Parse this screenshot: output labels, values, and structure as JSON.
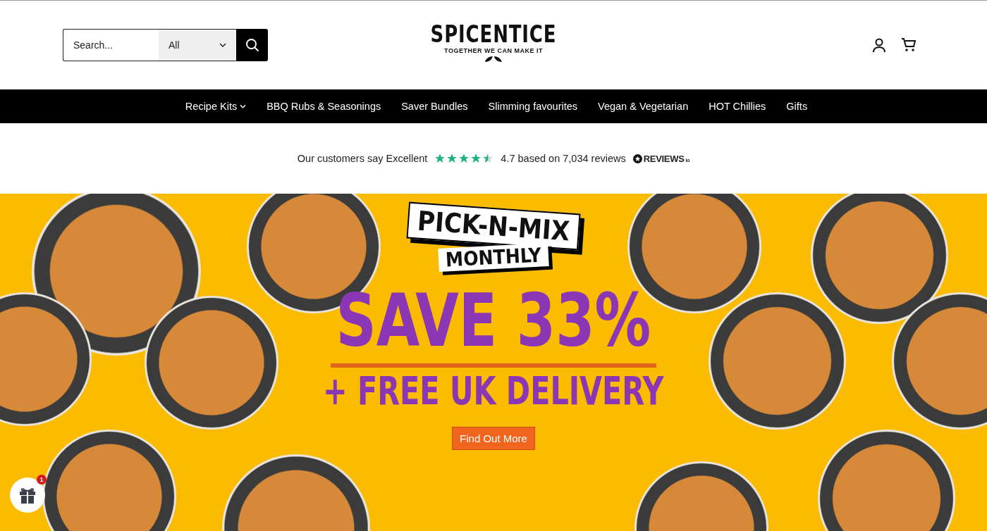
{
  "header": {
    "search": {
      "placeholder": "Search...",
      "category": "All"
    },
    "logo": {
      "name": "SPICENTICE",
      "tagline": "TOGETHER WE CAN MAKE IT"
    }
  },
  "nav": [
    {
      "label": "Recipe Kits",
      "has_dropdown": true
    },
    {
      "label": "BBQ Rubs & Seasonings",
      "has_dropdown": false
    },
    {
      "label": "Saver Bundles",
      "has_dropdown": false
    },
    {
      "label": "Slimming favourites",
      "has_dropdown": false
    },
    {
      "label": "Vegan & Vegetarian",
      "has_dropdown": false
    },
    {
      "label": "HOT Chillies",
      "has_dropdown": false
    },
    {
      "label": "Gifts",
      "has_dropdown": false
    }
  ],
  "reviews": {
    "lead": "Our customers say Excellent",
    "stars": 4.5,
    "summary": "4.7 based on 7,034 reviews",
    "brand": "REVIEWS",
    "brand_suffix": "io"
  },
  "banner": {
    "badge_top": "PICK-N-MIX",
    "badge_bottom": "MONTHLY",
    "headline": "SAVE 33%",
    "subline": "+ FREE UK DELIVERY",
    "button": "Find Out More"
  },
  "gift": {
    "count": "1"
  }
}
